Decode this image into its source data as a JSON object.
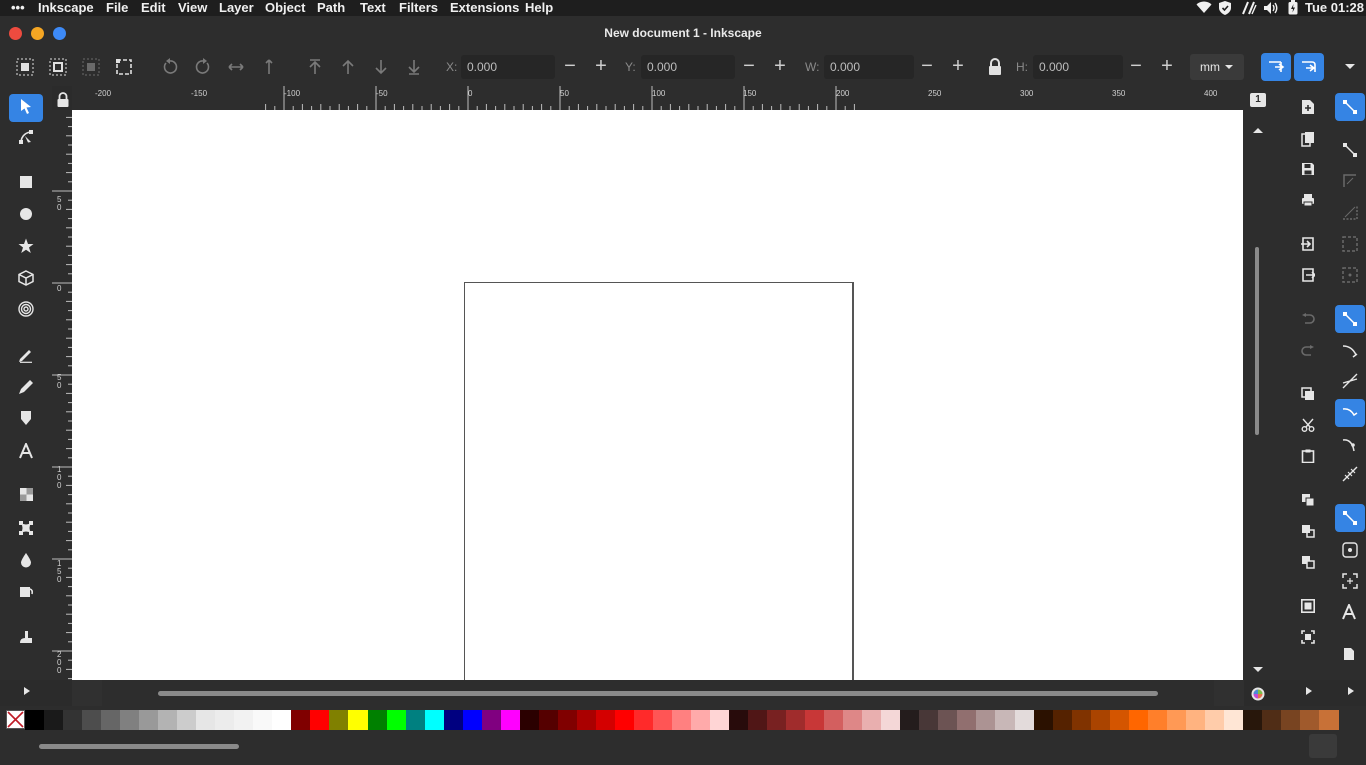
{
  "system_bar": {
    "app_menu_dots": "•••",
    "app_name": "Inkscape",
    "menus": [
      "File",
      "Edit",
      "View",
      "Layer",
      "Object",
      "Path",
      "Text",
      "Filters",
      "Extensions",
      "Help"
    ],
    "clock": "Tue 01:28"
  },
  "window": {
    "title": "New document 1 - Inkscape"
  },
  "command_bar": {
    "x_label": "X:",
    "x_value": "0.000",
    "y_label": "Y:",
    "y_value": "0.000",
    "w_label": "W:",
    "w_value": "0.000",
    "h_label": "H:",
    "h_value": "0.000",
    "unit": "mm"
  },
  "rulers": {
    "horizontal_labels": [
      "-200",
      "-150",
      "-100",
      "-50",
      "0",
      "50",
      "100",
      "150",
      "200",
      "250",
      "300",
      "350",
      "400"
    ],
    "vertical_labels": [
      "5 0",
      "0",
      "5 0",
      "1 0 0",
      "1 5 0",
      "2 0 0"
    ]
  },
  "right_pane": {
    "page_indicator": "1"
  },
  "palette": {
    "colors": [
      "#000000",
      "#1a1a1a",
      "#333333",
      "#4d4d4d",
      "#666666",
      "#808080",
      "#999999",
      "#b3b3b3",
      "#cccccc",
      "#e6e6e6",
      "#ececec",
      "#f2f2f2",
      "#f9f9f9",
      "#ffffff",
      "#800000",
      "#ff0000",
      "#808000",
      "#ffff00",
      "#008000",
      "#00ff00",
      "#008080",
      "#00ffff",
      "#000080",
      "#0000ff",
      "#800080",
      "#ff00ff",
      "#2b0000",
      "#550000",
      "#800000",
      "#aa0000",
      "#d40000",
      "#ff0000",
      "#ff2a2a",
      "#ff5555",
      "#ff8080",
      "#ffaaaa",
      "#ffd5d5",
      "#280b0b",
      "#501616",
      "#782121",
      "#a02c2c",
      "#c83737",
      "#d35f5f",
      "#de8787",
      "#e9afaf",
      "#f4d7d7",
      "#241c1c",
      "#483737",
      "#6c5353",
      "#916f6f",
      "#ac9393",
      "#c8b7b7",
      "#e3dbdb",
      "#2b1100",
      "#552200",
      "#803300",
      "#aa4400",
      "#d45500",
      "#ff6600",
      "#ff7f2a",
      "#ff9955",
      "#ffb380",
      "#ffccaa",
      "#ffe6d5",
      "#28170b",
      "#502d16",
      "#784421",
      "#a05a2c",
      "#c87137"
    ]
  },
  "colors": {
    "accent": "#3584e4",
    "canvas": "#ffffff",
    "chrome": "#2d2d2d"
  }
}
